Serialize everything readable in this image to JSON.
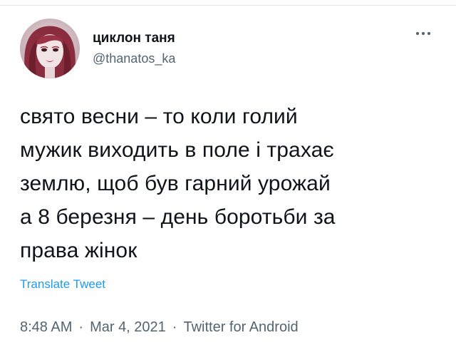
{
  "user": {
    "display_name": "циклон таня",
    "handle": "@thanatos_ka"
  },
  "tweet": {
    "text": "свято весни – то коли голий\nмужик виходить в поле і трахає\nземлю, щоб був гарний урожай\nа 8 березня – день боротьби за\nправа жінок",
    "translate_label": "Translate Tweet"
  },
  "meta": {
    "time": "8:48 AM",
    "separator": "·",
    "date": "Mar 4, 2021",
    "source": "Twitter for Android"
  },
  "icons": {
    "more": "more-dots-icon",
    "avatar": "profile-avatar"
  },
  "colors": {
    "text": "#0f1419",
    "secondary": "#536471",
    "link": "#1d9bf0"
  }
}
